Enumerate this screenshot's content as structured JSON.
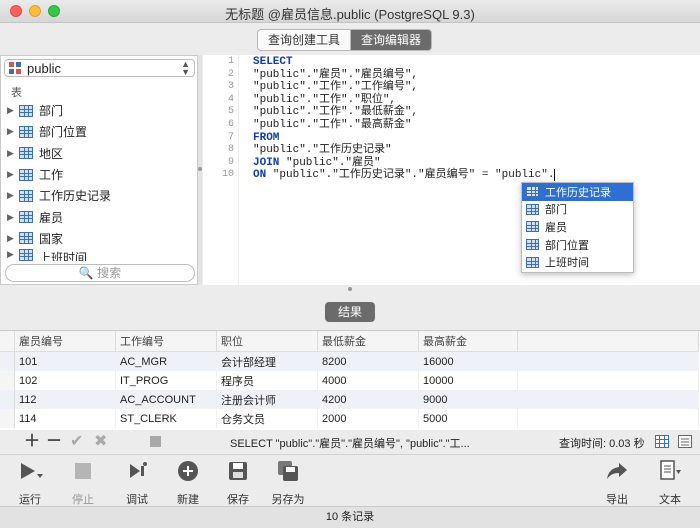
{
  "window": {
    "title": "无标题 @雇员信息.public (PostgreSQL 9.3)"
  },
  "mode_tabs": [
    {
      "label": "查询创建工具",
      "active": false
    },
    {
      "label": "查询编辑器",
      "active": true
    }
  ],
  "sidebar": {
    "schema": "public",
    "section_label": "表",
    "tables": [
      "部门",
      "部门位置",
      "地区",
      "工作",
      "工作历史记录",
      "雇员",
      "国家",
      "上班时间"
    ],
    "search_placeholder": "搜索"
  },
  "editor": {
    "line_numbers": [
      "1",
      "2",
      "3",
      "4",
      "5",
      "6",
      "7",
      "8",
      "9",
      "10"
    ],
    "lines": [
      {
        "kw": "SELECT",
        "text": ""
      },
      {
        "kw": "",
        "text": "\"public\".\"雇员\".\"雇员编号\","
      },
      {
        "kw": "",
        "text": "\"public\".\"工作\".\"工作编号\","
      },
      {
        "kw": "",
        "text": "\"public\".\"工作\".\"职位\","
      },
      {
        "kw": "",
        "text": "\"public\".\"工作\".\"最低薪金\","
      },
      {
        "kw": "",
        "text": "\"public\".\"工作\".\"最高薪金\""
      },
      {
        "kw": "FROM",
        "text": ""
      },
      {
        "kw": "",
        "text": "\"public\".\"工作历史记录\""
      },
      {
        "kw": "JOIN",
        "text": " \"public\".\"雇员\""
      },
      {
        "kw": "ON",
        "text": " \"public\".\"工作历史记录\".\"雇员编号\" = \"public\"."
      }
    ],
    "autocomplete": [
      "工作历史记录",
      "部门",
      "雇员",
      "部门位置",
      "上班时间"
    ]
  },
  "result_label": "结果",
  "grid": {
    "columns": [
      "雇员编号",
      "工作编号",
      "职位",
      "最低薪金",
      "最高薪金"
    ],
    "rows": [
      [
        "101",
        "AC_MGR",
        "会计部经理",
        "8200",
        "16000"
      ],
      [
        "102",
        "IT_PROG",
        "程序员",
        "4000",
        "10000"
      ],
      [
        "112",
        "AC_ACCOUNT",
        "注册会计师",
        "4200",
        "9000"
      ],
      [
        "114",
        "ST_CLERK",
        "仓务文员",
        "2000",
        "5000"
      ]
    ]
  },
  "statusbar": {
    "sql_preview": "SELECT \"public\".\"雇员\".\"雇员编号\", \"public\".\"工...",
    "query_time": "查询时间: 0.03 秒"
  },
  "toolbar": {
    "run": "运行",
    "stop": "停止",
    "debug": "调试",
    "new": "新建",
    "save": "保存",
    "save_as": "另存为",
    "export": "导出",
    "text": "文本"
  },
  "footer": {
    "records": "10 条记录"
  }
}
